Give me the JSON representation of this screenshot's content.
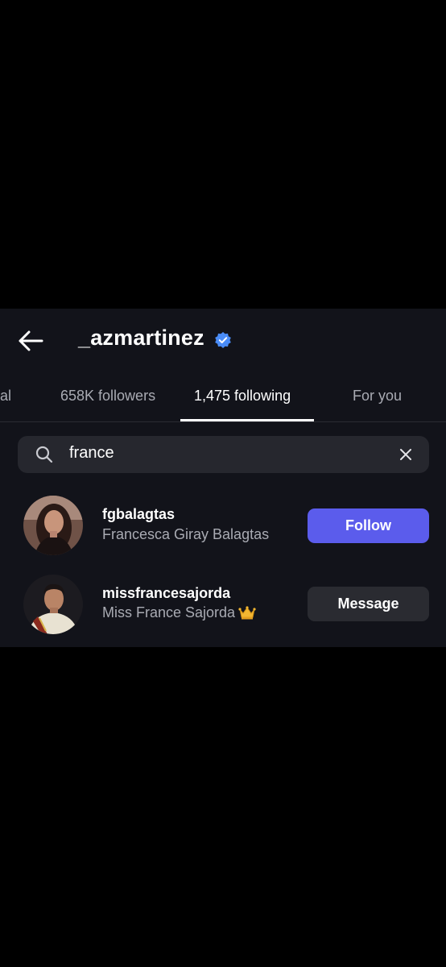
{
  "header": {
    "username": "_azmartinez",
    "verified": true,
    "badge_color": "#4a8cf7"
  },
  "tabs": [
    {
      "label": "al"
    },
    {
      "label": "658K followers"
    },
    {
      "label": "1,475 following",
      "active": true
    },
    {
      "label": "For you"
    }
  ],
  "search": {
    "value": "france"
  },
  "results": [
    {
      "username": "fgbalagtas",
      "full_name": "Francesca Giray Balagtas",
      "button": "Follow"
    },
    {
      "username": "missfrancesajorda",
      "full_name": "Miss France Sajorda",
      "button": "Message"
    }
  ],
  "colors": {
    "background": "#000000",
    "panel": "#12131a",
    "follow_button": "#5b5cec",
    "message_button": "#2a2b31"
  }
}
